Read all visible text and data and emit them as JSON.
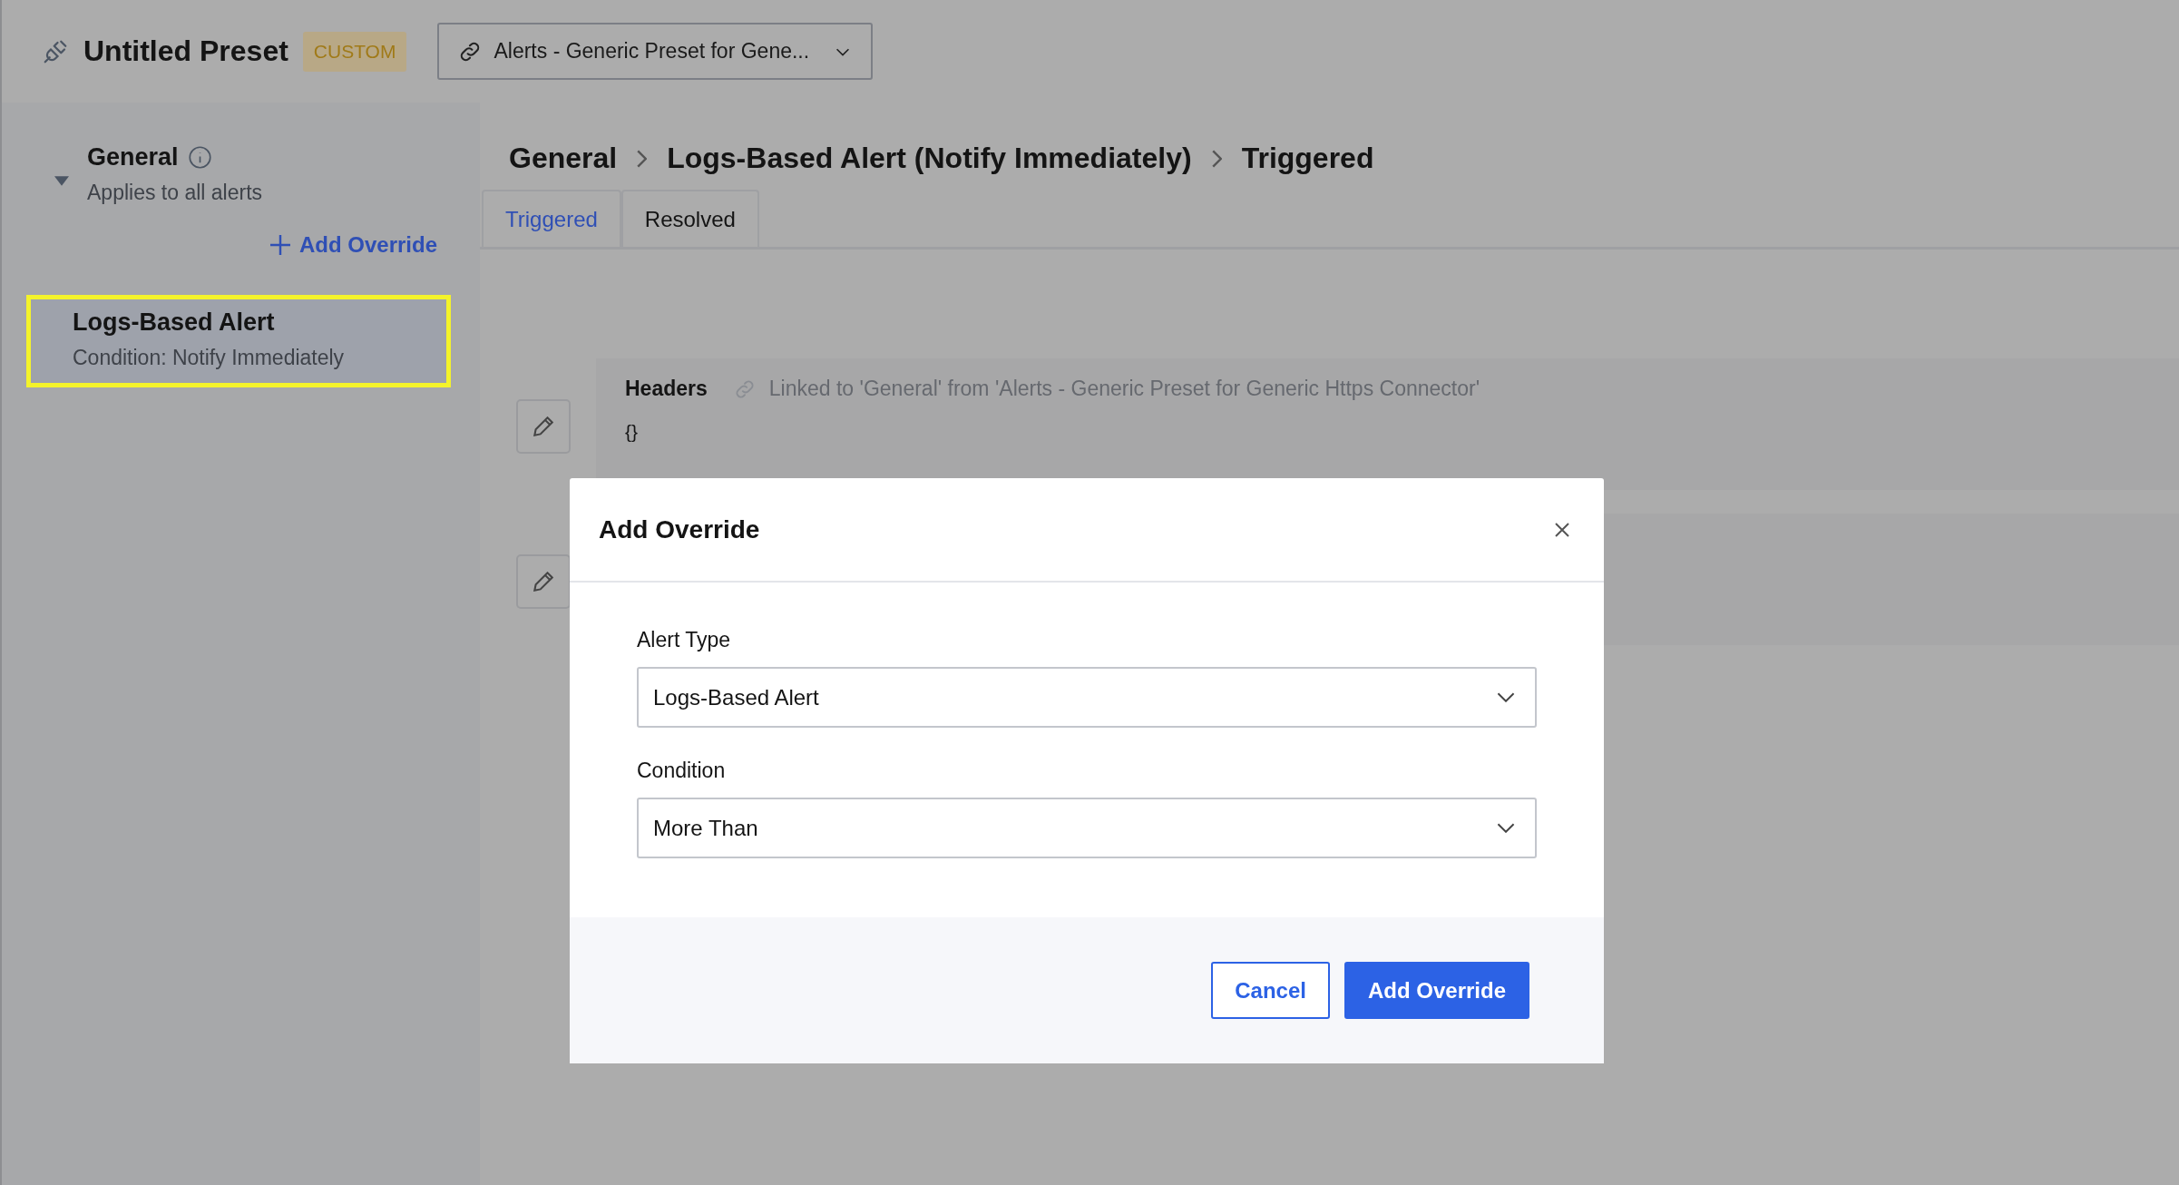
{
  "header": {
    "title": "Untitled Preset",
    "badge": "CUSTOM",
    "preset_dropdown": {
      "value": "Alerts - Generic Preset for Gene..."
    }
  },
  "sidebar": {
    "groups": [
      {
        "title": "General",
        "subtitle": "Applies to all alerts",
        "expanded": true,
        "add_link": "Add Override",
        "items": [
          {
            "title": "Logs-Based Alert",
            "subtitle": "Condition: Notify Immediately",
            "selected": true
          }
        ]
      }
    ]
  },
  "breadcrumb": [
    "General",
    "Logs-Based Alert (Notify Immediately)",
    "Triggered"
  ],
  "tabs": [
    {
      "label": "Triggered",
      "selected": true
    },
    {
      "label": "Resolved",
      "selected": false
    }
  ],
  "panels": [
    {
      "kind": "text",
      "title": "Headers",
      "linked_note": "Linked to 'General' from 'Alerts - Generic Preset for Generic Https Connector'",
      "value": "{}"
    },
    {
      "kind": "blank"
    }
  ],
  "modal": {
    "title": "Add Override",
    "fields": [
      {
        "label": "Alert Type",
        "value": "Logs-Based Alert"
      },
      {
        "label": "Condition",
        "value": "More Than"
      }
    ],
    "buttons": [
      {
        "label": "Cancel",
        "kind": "secondary"
      },
      {
        "label": "Add Override",
        "kind": "primary"
      }
    ]
  }
}
